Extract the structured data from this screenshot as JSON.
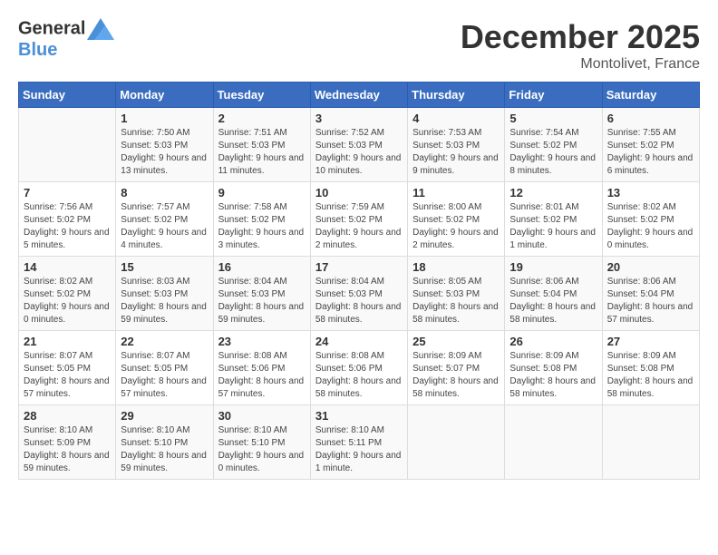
{
  "logo": {
    "line1": "General",
    "line2": "Blue"
  },
  "title": "December 2025",
  "location": "Montolivet, France",
  "days_header": [
    "Sunday",
    "Monday",
    "Tuesday",
    "Wednesday",
    "Thursday",
    "Friday",
    "Saturday"
  ],
  "weeks": [
    [
      {
        "day": "",
        "sunrise": "",
        "sunset": "",
        "daylight": ""
      },
      {
        "day": "1",
        "sunrise": "Sunrise: 7:50 AM",
        "sunset": "Sunset: 5:03 PM",
        "daylight": "Daylight: 9 hours and 13 minutes."
      },
      {
        "day": "2",
        "sunrise": "Sunrise: 7:51 AM",
        "sunset": "Sunset: 5:03 PM",
        "daylight": "Daylight: 9 hours and 11 minutes."
      },
      {
        "day": "3",
        "sunrise": "Sunrise: 7:52 AM",
        "sunset": "Sunset: 5:03 PM",
        "daylight": "Daylight: 9 hours and 10 minutes."
      },
      {
        "day": "4",
        "sunrise": "Sunrise: 7:53 AM",
        "sunset": "Sunset: 5:03 PM",
        "daylight": "Daylight: 9 hours and 9 minutes."
      },
      {
        "day": "5",
        "sunrise": "Sunrise: 7:54 AM",
        "sunset": "Sunset: 5:02 PM",
        "daylight": "Daylight: 9 hours and 8 minutes."
      },
      {
        "day": "6",
        "sunrise": "Sunrise: 7:55 AM",
        "sunset": "Sunset: 5:02 PM",
        "daylight": "Daylight: 9 hours and 6 minutes."
      }
    ],
    [
      {
        "day": "7",
        "sunrise": "Sunrise: 7:56 AM",
        "sunset": "Sunset: 5:02 PM",
        "daylight": "Daylight: 9 hours and 5 minutes."
      },
      {
        "day": "8",
        "sunrise": "Sunrise: 7:57 AM",
        "sunset": "Sunset: 5:02 PM",
        "daylight": "Daylight: 9 hours and 4 minutes."
      },
      {
        "day": "9",
        "sunrise": "Sunrise: 7:58 AM",
        "sunset": "Sunset: 5:02 PM",
        "daylight": "Daylight: 9 hours and 3 minutes."
      },
      {
        "day": "10",
        "sunrise": "Sunrise: 7:59 AM",
        "sunset": "Sunset: 5:02 PM",
        "daylight": "Daylight: 9 hours and 2 minutes."
      },
      {
        "day": "11",
        "sunrise": "Sunrise: 8:00 AM",
        "sunset": "Sunset: 5:02 PM",
        "daylight": "Daylight: 9 hours and 2 minutes."
      },
      {
        "day": "12",
        "sunrise": "Sunrise: 8:01 AM",
        "sunset": "Sunset: 5:02 PM",
        "daylight": "Daylight: 9 hours and 1 minute."
      },
      {
        "day": "13",
        "sunrise": "Sunrise: 8:02 AM",
        "sunset": "Sunset: 5:02 PM",
        "daylight": "Daylight: 9 hours and 0 minutes."
      }
    ],
    [
      {
        "day": "14",
        "sunrise": "Sunrise: 8:02 AM",
        "sunset": "Sunset: 5:02 PM",
        "daylight": "Daylight: 9 hours and 0 minutes."
      },
      {
        "day": "15",
        "sunrise": "Sunrise: 8:03 AM",
        "sunset": "Sunset: 5:03 PM",
        "daylight": "Daylight: 8 hours and 59 minutes."
      },
      {
        "day": "16",
        "sunrise": "Sunrise: 8:04 AM",
        "sunset": "Sunset: 5:03 PM",
        "daylight": "Daylight: 8 hours and 59 minutes."
      },
      {
        "day": "17",
        "sunrise": "Sunrise: 8:04 AM",
        "sunset": "Sunset: 5:03 PM",
        "daylight": "Daylight: 8 hours and 58 minutes."
      },
      {
        "day": "18",
        "sunrise": "Sunrise: 8:05 AM",
        "sunset": "Sunset: 5:03 PM",
        "daylight": "Daylight: 8 hours and 58 minutes."
      },
      {
        "day": "19",
        "sunrise": "Sunrise: 8:06 AM",
        "sunset": "Sunset: 5:04 PM",
        "daylight": "Daylight: 8 hours and 58 minutes."
      },
      {
        "day": "20",
        "sunrise": "Sunrise: 8:06 AM",
        "sunset": "Sunset: 5:04 PM",
        "daylight": "Daylight: 8 hours and 57 minutes."
      }
    ],
    [
      {
        "day": "21",
        "sunrise": "Sunrise: 8:07 AM",
        "sunset": "Sunset: 5:05 PM",
        "daylight": "Daylight: 8 hours and 57 minutes."
      },
      {
        "day": "22",
        "sunrise": "Sunrise: 8:07 AM",
        "sunset": "Sunset: 5:05 PM",
        "daylight": "Daylight: 8 hours and 57 minutes."
      },
      {
        "day": "23",
        "sunrise": "Sunrise: 8:08 AM",
        "sunset": "Sunset: 5:06 PM",
        "daylight": "Daylight: 8 hours and 57 minutes."
      },
      {
        "day": "24",
        "sunrise": "Sunrise: 8:08 AM",
        "sunset": "Sunset: 5:06 PM",
        "daylight": "Daylight: 8 hours and 58 minutes."
      },
      {
        "day": "25",
        "sunrise": "Sunrise: 8:09 AM",
        "sunset": "Sunset: 5:07 PM",
        "daylight": "Daylight: 8 hours and 58 minutes."
      },
      {
        "day": "26",
        "sunrise": "Sunrise: 8:09 AM",
        "sunset": "Sunset: 5:08 PM",
        "daylight": "Daylight: 8 hours and 58 minutes."
      },
      {
        "day": "27",
        "sunrise": "Sunrise: 8:09 AM",
        "sunset": "Sunset: 5:08 PM",
        "daylight": "Daylight: 8 hours and 58 minutes."
      }
    ],
    [
      {
        "day": "28",
        "sunrise": "Sunrise: 8:10 AM",
        "sunset": "Sunset: 5:09 PM",
        "daylight": "Daylight: 8 hours and 59 minutes."
      },
      {
        "day": "29",
        "sunrise": "Sunrise: 8:10 AM",
        "sunset": "Sunset: 5:10 PM",
        "daylight": "Daylight: 8 hours and 59 minutes."
      },
      {
        "day": "30",
        "sunrise": "Sunrise: 8:10 AM",
        "sunset": "Sunset: 5:10 PM",
        "daylight": "Daylight: 9 hours and 0 minutes."
      },
      {
        "day": "31",
        "sunrise": "Sunrise: 8:10 AM",
        "sunset": "Sunset: 5:11 PM",
        "daylight": "Daylight: 9 hours and 1 minute."
      },
      {
        "day": "",
        "sunrise": "",
        "sunset": "",
        "daylight": ""
      },
      {
        "day": "",
        "sunrise": "",
        "sunset": "",
        "daylight": ""
      },
      {
        "day": "",
        "sunrise": "",
        "sunset": "",
        "daylight": ""
      }
    ]
  ]
}
